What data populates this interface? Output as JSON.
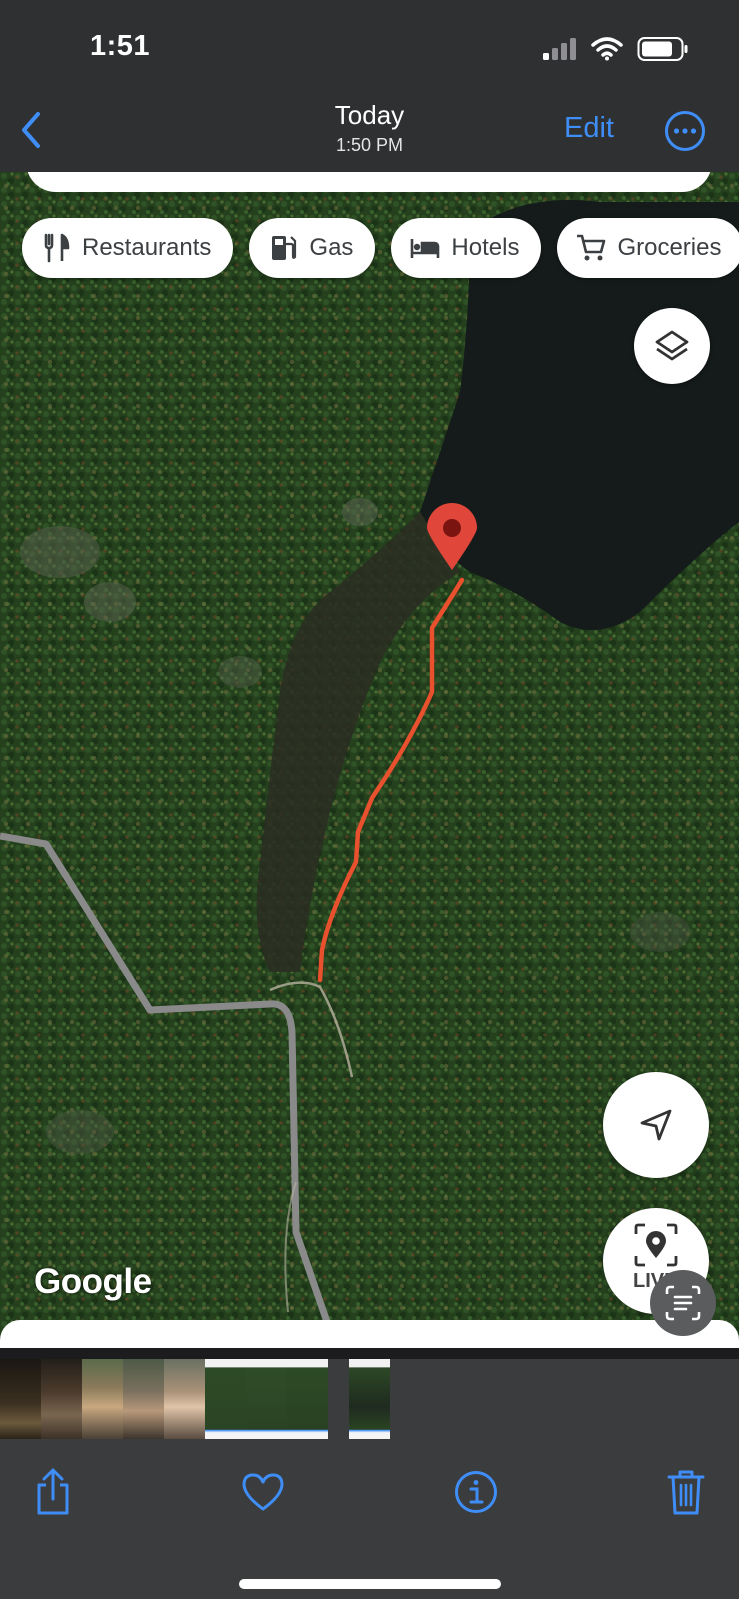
{
  "status_bar": {
    "time": "1:51"
  },
  "nav": {
    "title": "Today",
    "subtitle": "1:50 PM",
    "edit_label": "Edit"
  },
  "map": {
    "chips": [
      {
        "icon": "fork-knife-icon",
        "label": "Restaurants"
      },
      {
        "icon": "gas-pump-icon",
        "label": "Gas"
      },
      {
        "icon": "bed-icon",
        "label": "Hotels"
      },
      {
        "icon": "cart-icon",
        "label": "Groceries"
      }
    ],
    "logo_text": "Google",
    "live_label": "LIVE",
    "route_color": "#e8502e",
    "pin_color": "#e0463a"
  },
  "toolbar": {
    "share_icon": "share-icon",
    "favorite_icon": "heart-icon",
    "info_icon": "info-icon",
    "delete_icon": "trash-icon"
  },
  "colors": {
    "accent": "#3f8ef8",
    "bar_background": "#3b3c3e"
  }
}
